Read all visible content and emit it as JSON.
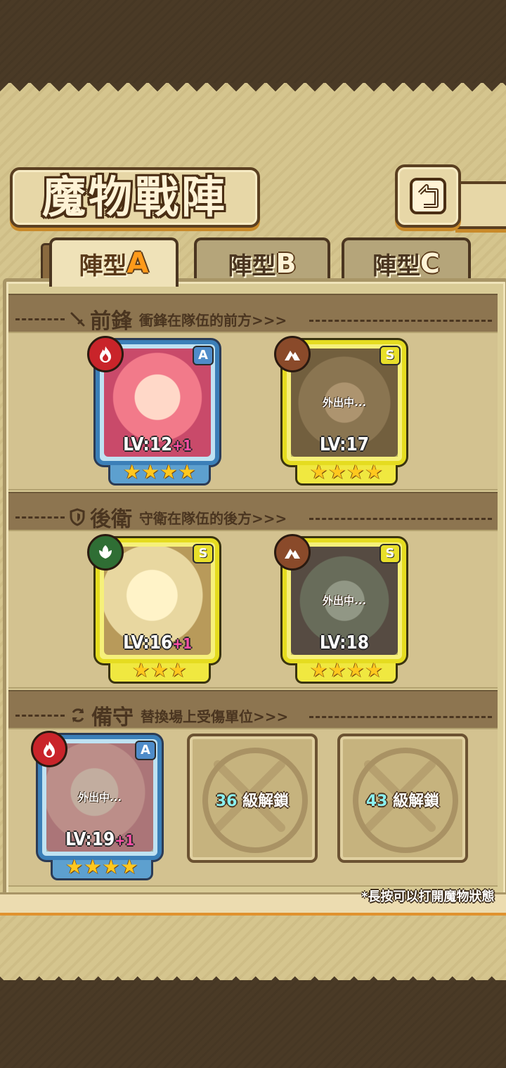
{
  "header": {
    "title": "魔物戰陣",
    "back_icon": "back-arrow-icon"
  },
  "tabs": [
    {
      "label": "陣型",
      "letter": "A",
      "active": true
    },
    {
      "label": "陣型",
      "letter": "B",
      "active": false
    },
    {
      "label": "陣型",
      "letter": "C",
      "active": false
    }
  ],
  "sections": {
    "vanguard": {
      "icon": "sword-icon",
      "title": "前鋒",
      "desc": "衝鋒在隊伍的前方>>>"
    },
    "rearguard": {
      "icon": "shield-icon",
      "title": "後衛",
      "desc": "守衛在隊伍的後方>>>"
    },
    "reserve": {
      "icon": "swap-icon",
      "title": "備守",
      "desc": "替換場上受傷單位>>>"
    }
  },
  "vanguard": [
    {
      "element": "fire",
      "rarity": "A",
      "level": "LV:12",
      "bonus": "+1",
      "stars": 4,
      "away_text": ""
    },
    {
      "element": "earth",
      "rarity": "S",
      "level": "LV:17",
      "bonus": "",
      "stars": 4,
      "away_text": "外出中..."
    }
  ],
  "rearguard": [
    {
      "element": "wood",
      "rarity": "S",
      "level": "LV:16",
      "bonus": "+1",
      "stars": 3,
      "away_text": ""
    },
    {
      "element": "earth",
      "rarity": "S",
      "level": "LV:18",
      "bonus": "",
      "stars": 4,
      "away_text": "外出中..."
    }
  ],
  "reserve": {
    "monster": {
      "element": "fire",
      "rarity": "A",
      "level": "LV:19",
      "bonus": "+1",
      "stars": 4,
      "away_text": "外出中..."
    },
    "locked": [
      {
        "level": "36",
        "label": "級解鎖"
      },
      {
        "level": "43",
        "label": "級解鎖"
      }
    ]
  },
  "footnote": "*長按可以打開魔物狀態",
  "colors": {
    "rarity_A": "#3b7fb8",
    "rarity_S": "#e5dc20",
    "fire": "#c9242a",
    "earth": "#8a4a2a",
    "wood": "#2f6e34",
    "accent": "#ff9a1a"
  }
}
